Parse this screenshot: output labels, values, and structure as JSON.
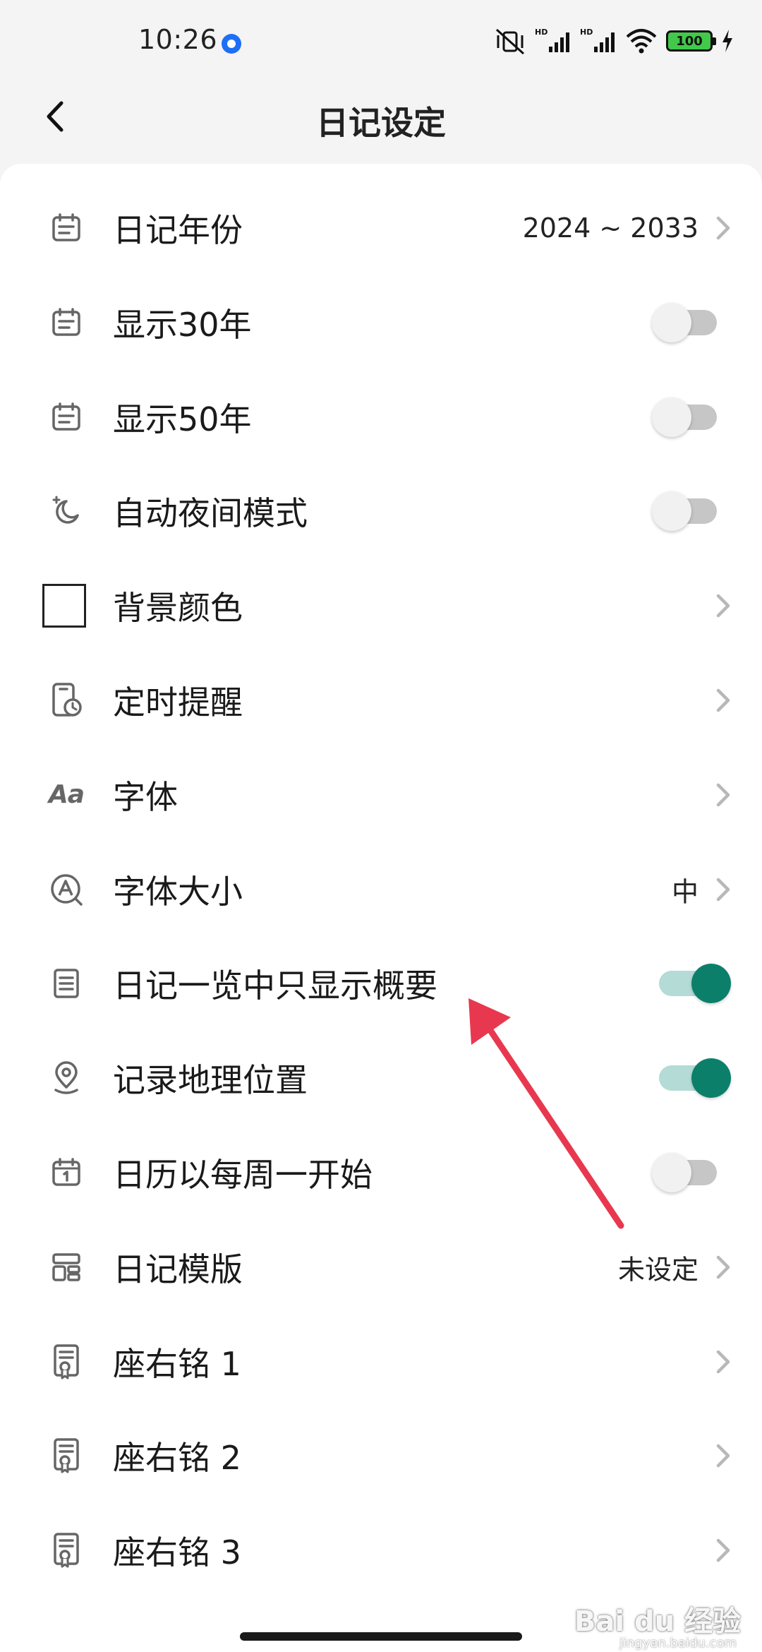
{
  "status_bar": {
    "time": "10:26",
    "battery": "100"
  },
  "header": {
    "title": "日记设定"
  },
  "settings": [
    {
      "label": "日记年份",
      "value": "2024 ~ 2033",
      "control": "chevron",
      "icon": "calendar-icon"
    },
    {
      "label": "显示30年",
      "control": "toggle",
      "on": false,
      "icon": "calendar-icon"
    },
    {
      "label": "显示50年",
      "control": "toggle",
      "on": false,
      "icon": "calendar-icon"
    },
    {
      "label": "自动夜间模式",
      "control": "toggle",
      "on": false,
      "icon": "moon-icon"
    },
    {
      "label": "背景颜色",
      "control": "chevron",
      "icon": "color-swatch-icon"
    },
    {
      "label": "定时提醒",
      "control": "chevron",
      "icon": "phone-clock-icon"
    },
    {
      "label": "字体",
      "control": "chevron",
      "icon": "font-icon",
      "icon_text": "Aa"
    },
    {
      "label": "字体大小",
      "value": "中",
      "control": "chevron",
      "icon": "font-size-icon"
    },
    {
      "label": "日记一览中只显示概要",
      "control": "toggle",
      "on": true,
      "icon": "document-icon"
    },
    {
      "label": "记录地理位置",
      "control": "toggle",
      "on": true,
      "icon": "location-pin-icon"
    },
    {
      "label": "日历以每周一开始",
      "control": "toggle",
      "on": false,
      "icon": "calendar-one-icon"
    },
    {
      "label": "日记模版",
      "value": "未设定",
      "control": "chevron",
      "icon": "template-icon"
    },
    {
      "label": "座右铭 1",
      "control": "chevron",
      "icon": "certificate-icon"
    },
    {
      "label": "座右铭 2",
      "control": "chevron",
      "icon": "certificate-icon"
    },
    {
      "label": "座右铭 3",
      "control": "chevron",
      "icon": "certificate-icon"
    }
  ],
  "watermark": {
    "text": "Bai du 经验",
    "sub": "jingyan.baidu.com"
  },
  "colors": {
    "toggle_on_knob": "#0c7f6b",
    "toggle_on_track": "#b4dbd5",
    "arrow": "#e8384f"
  }
}
